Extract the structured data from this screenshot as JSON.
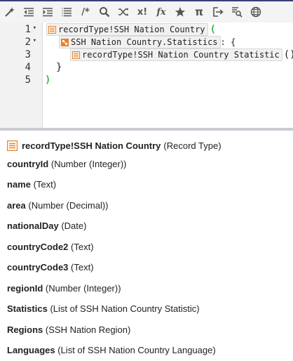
{
  "toolbar": {
    "buttons": [
      {
        "name": "magic-wand-icon"
      },
      {
        "name": "outdent-icon"
      },
      {
        "name": "indent-icon"
      },
      {
        "name": "list-icon"
      },
      {
        "name": "comment-icon",
        "text": "/*"
      },
      {
        "name": "search-icon"
      },
      {
        "name": "shuffle-icon"
      },
      {
        "name": "function-x-icon",
        "text": "x!"
      },
      {
        "name": "fx-icon",
        "text": "fx"
      },
      {
        "name": "star-icon"
      },
      {
        "name": "pi-icon",
        "text": "π"
      },
      {
        "name": "export-icon"
      },
      {
        "name": "find-replace-icon"
      },
      {
        "name": "globe-icon"
      }
    ]
  },
  "editor": {
    "line_numbers": [
      "1",
      "2",
      "3",
      "4",
      "5"
    ],
    "fold_marker": "▾",
    "line1_token": "recordType!SSH Nation Country",
    "line1_paren": "(",
    "line2_token": "SSH Nation Country.Statistics",
    "line2_suffix": " : {",
    "line3_token": "recordType!SSH Nation Country Statistic",
    "line3_suffix": "()",
    "line4_text": "}",
    "line5_paren": ")"
  },
  "info": {
    "record_name": "recordType!SSH Nation Country",
    "record_kind": "(Record Type)",
    "fields": [
      {
        "name": "countryId",
        "type": "(Number (Integer))"
      },
      {
        "name": "name",
        "type": "(Text)"
      },
      {
        "name": "area",
        "type": "(Number (Decimal))"
      },
      {
        "name": "nationalDay",
        "type": "(Date)"
      },
      {
        "name": "countryCode2",
        "type": "(Text)"
      },
      {
        "name": "countryCode3",
        "type": "(Text)"
      },
      {
        "name": "regionId",
        "type": "(Number (Integer))"
      },
      {
        "name": "Statistics",
        "type": "(List of SSH Nation Country Statistic)"
      },
      {
        "name": "Regions",
        "type": "(SSH Nation Region)"
      },
      {
        "name": "Languages",
        "type": "(List of SSH Nation Country Language)"
      }
    ]
  },
  "colors": {
    "accent_orange": "#e8822a",
    "paren_green": "#2fbf4a",
    "top_bar": "#3b3d7a"
  }
}
